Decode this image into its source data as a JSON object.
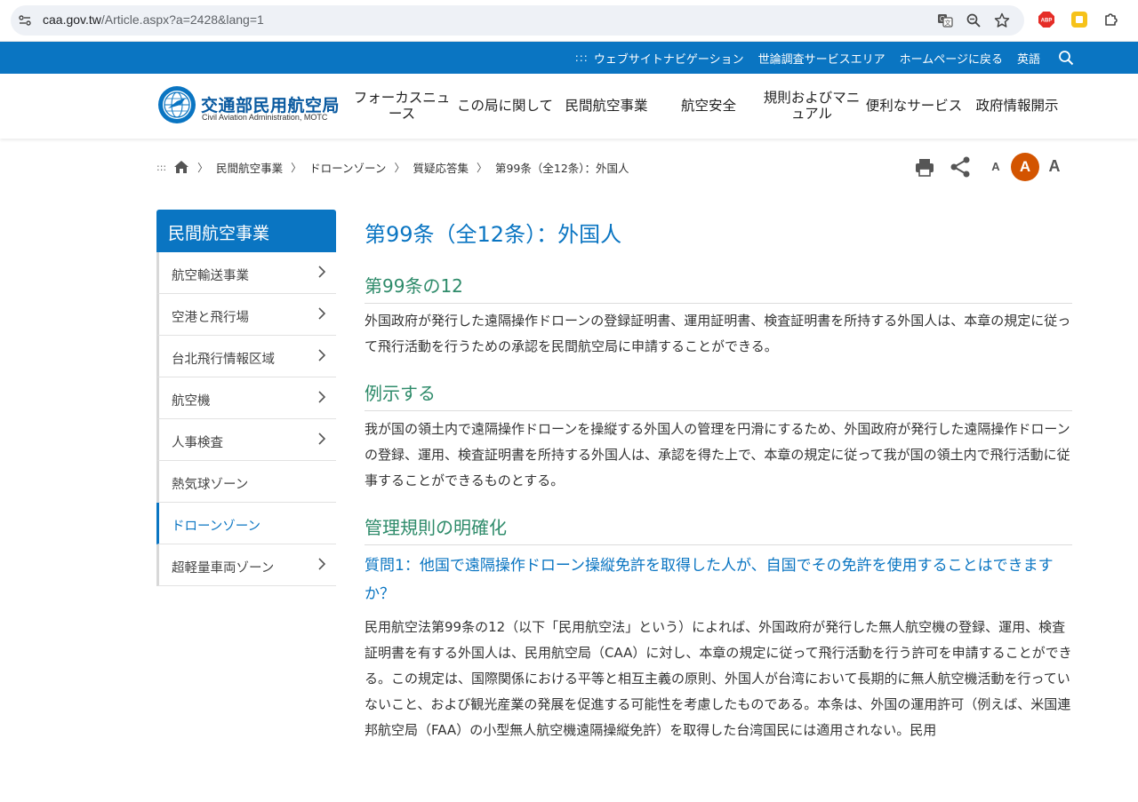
{
  "browser": {
    "url_host": "caa.gov.tw",
    "url_path": "/Article.aspx?a=2428&lang=1",
    "abp_label": "ABP"
  },
  "topbar": {
    "dots": ":::",
    "links": [
      "ウェブサイトナビゲーション",
      "世論調査サービスエリア",
      "ホームページに戻る",
      "英語"
    ]
  },
  "header": {
    "logo_title": "交通部民用航空局",
    "logo_subtitle": "Civil Aviation Administration, MOTC",
    "nav": [
      {
        "label": "フォーカスニュ\nース"
      },
      {
        "label": "この局に関して"
      },
      {
        "label": "民間航空事業"
      },
      {
        "label": "航空安全"
      },
      {
        "label": "規則およびマニ\nュアル"
      },
      {
        "label": "便利なサービス"
      },
      {
        "label": "政府情報開示"
      }
    ]
  },
  "breadcrumb": {
    "dots": ":::",
    "items": [
      "民間航空事業",
      "ドローンゾーン",
      "質疑応答集",
      "第99条（全12条）：外国人"
    ]
  },
  "font_sizes": {
    "small": "A",
    "medium": "A",
    "large": "A",
    "active_color": "#d35400"
  },
  "sidebar": {
    "title": "民間航空事業",
    "items": [
      {
        "label": "航空輸送事業",
        "has_children": true
      },
      {
        "label": "空港と飛行場",
        "has_children": true
      },
      {
        "label": "台北飛行情報区域",
        "has_children": true
      },
      {
        "label": "航空機",
        "has_children": true
      },
      {
        "label": "人事検査",
        "has_children": true
      },
      {
        "label": "熱気球ゾーン",
        "has_children": false
      },
      {
        "label": "ドローンゾーン",
        "has_children": false,
        "active": true
      },
      {
        "label": "超軽量車両ゾーン",
        "has_children": true
      }
    ]
  },
  "article": {
    "title": "第99条（全12条）：外国人",
    "section1_heading": "第99条の12",
    "section1_text": "外国政府が発行した遠隔操作ドローンの登録証明書、運用証明書、検査証明書を所持する外国人は、本章の規定に従って飛行活動を行うための承認を民間航空局に申請することができる。",
    "section2_heading": "例示する",
    "section2_text": "我が国の領土内で遠隔操作ドローンを操縦する外国人の管理を円滑にするため、外国政府が発行した遠隔操作ドローンの登録、運用、検査証明書を所持する外国人は、承認を得た上で、本章の規定に従って我が国の領土内で飛行活動に従事することができるものとする。",
    "section3_heading": "管理規則の明確化",
    "question1": "質問1：他国で遠隔操作ドローン操縦免許を取得した人が、自国でその免許を使用することはできますか？",
    "answer1": "民用航空法第99条の12（以下「民用航空法」という）によれば、外国政府が発行した無人航空機の登録、運用、検査証明書を有する外国人は、民用航空局（CAA）に対し、本章の規定に従って飛行活動を行う許可を申請することができる。この規定は、国際関係における平等と相互主義の原則、外国人が台湾において長期的に無人航空機活動を行っていないこと、および観光産業の発展を促進する可能性を考慮したものである。本条は、外国の運用許可（例えば、米国連邦航空局（FAA）の小型無人航空機遠隔操縦免許）を取得した台湾国民には適用されない。民用"
  }
}
